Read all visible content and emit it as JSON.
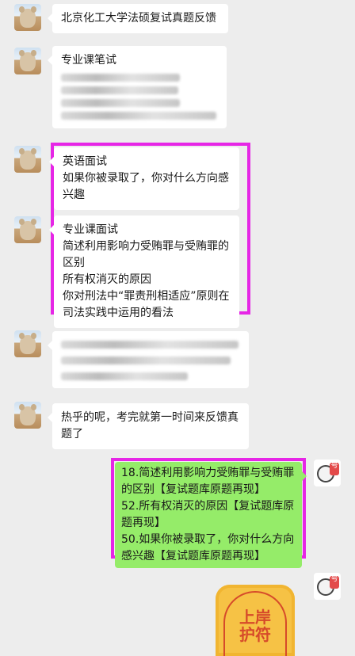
{
  "messages": [
    {
      "side": "left",
      "lines": [
        "北京化工大学法硕复试真题反馈"
      ]
    },
    {
      "side": "left",
      "lines": [
        "专业课笔试"
      ],
      "blurred_lines": 4
    },
    {
      "side": "left",
      "lines": [
        "英语面试",
        "如果你被录取了，你对什么方向感兴趣"
      ]
    },
    {
      "side": "left",
      "lines": [
        "专业课面试",
        "简述利用影响力受贿罪与受贿罪的区别",
        "所有权消灭的原因",
        "你对刑法中“罪责刑相适应”原则在司法实践中运用的看法"
      ]
    },
    {
      "side": "left",
      "blurred_lines": 3
    },
    {
      "side": "left",
      "lines": [
        "热乎的呢，考完就第一时间来反馈真题了"
      ]
    },
    {
      "side": "right",
      "lines": [
        "18.简述利用影响力受贿罪与受贿罪的区别【复试题库原题再现】",
        "52.所有权消灭的原因【复试题库原题再现】",
        "50.如果你被录取了，你对什么方向感兴趣【复试题库原题再现】"
      ]
    }
  ],
  "sticker": {
    "line1": "上岸",
    "line2": "护符"
  },
  "colors": {
    "background": "#ededed",
    "bubble_left": "#ffffff",
    "bubble_right": "#95ec69",
    "highlight": "#e626e6"
  }
}
